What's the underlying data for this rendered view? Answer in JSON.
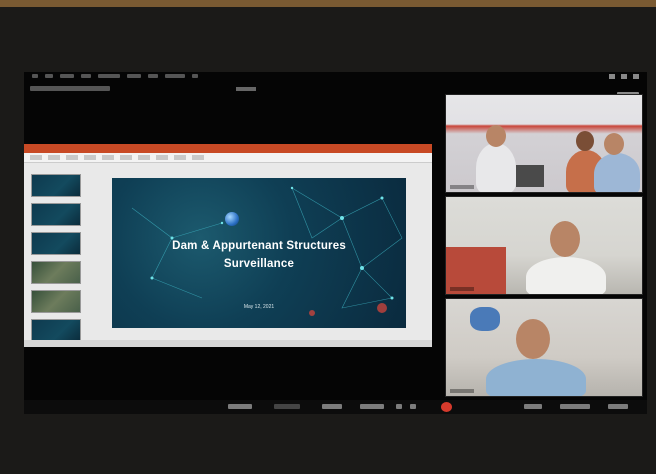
{
  "window": {
    "menu_items": [
      "",
      "",
      "",
      "",
      "",
      "",
      "",
      "",
      ""
    ],
    "view_button_icon": "view-toggle"
  },
  "presentation": {
    "slide": {
      "title_line1": "Dam & Appurtenant Structures",
      "title_line2": "Surveillance",
      "date": "May 12, 2021"
    },
    "thumbnail_count": 6
  },
  "participants": [
    {
      "tile": "video-tile-1",
      "people": 3
    },
    {
      "tile": "video-tile-2",
      "people": 1
    },
    {
      "tile": "video-tile-3",
      "people": 1
    }
  ],
  "colors": {
    "background": "#1b1a18",
    "leave_button": "#d63a2c",
    "slide_bg": "#0f3f55",
    "ppt_ribbon": "#c84a25"
  }
}
